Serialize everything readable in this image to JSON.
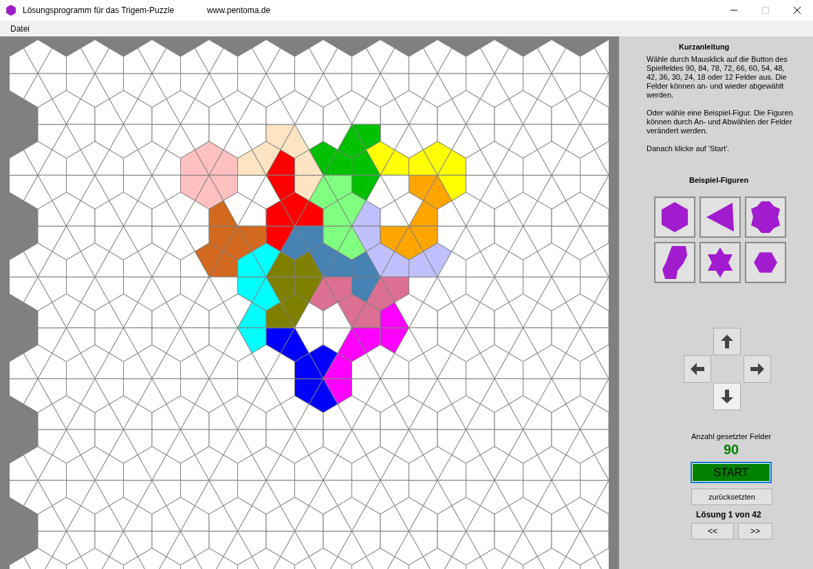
{
  "window": {
    "title": "Lösungsprogramm für das Trigem-Puzzle",
    "url": "www.pentoma.de"
  },
  "menu": [
    "Datei"
  ],
  "board": {
    "rows": [
      [
        {
          "kites": [
            {
              "color": "#ffffff"
            },
            {
              "color": "#ffffff"
            },
            {
              "color": "#ffffff"
            },
            {
              "color": "#ffffff"
            },
            {
              "color": "#ffffff"
            },
            {
              "color": "#ffffff"
            }
          ]
        },
        {
          "kites": [
            {
              "color": "#ffffff"
            },
            {
              "color": "#ffffff"
            },
            {
              "color": "#ffffff"
            },
            {
              "color": "#ffffff"
            },
            {
              "color": "#ffffff"
            },
            {
              "color": "#ffffff"
            }
          ]
        },
        {
          "kites": [
            {
              "color": "#ffffff"
            },
            {
              "color": "#ffffff"
            },
            {
              "color": "#ffffff"
            },
            {
              "color": "#ffffff"
            },
            {
              "color": "#ffffff"
            },
            {
              "color": "#ffffff"
            }
          ]
        },
        {
          "kites": [
            {
              "color": "#ffffff"
            },
            {
              "color": "#ffffff"
            },
            {
              "color": "#ffffff"
            },
            {
              "color": "#ffffff"
            },
            {
              "color": "#ffffff"
            },
            {
              "color": "#ffffff"
            }
          ]
        },
        {
          "kites": [
            {
              "color": "#ffffff"
            },
            {
              "color": "#ffffff"
            },
            {
              "color": "#ffffff"
            },
            {
              "color": "#ffe4c4"
            },
            {
              "color": "#ffe4c4"
            },
            {
              "color": "#ffffff"
            }
          ]
        },
        {
          "kites": [
            {
              "color": "#ffffff"
            },
            {
              "color": "#ffffff"
            },
            {
              "color": "#00c000"
            },
            {
              "color": "#00c000"
            },
            {
              "color": "#ffffff"
            },
            {
              "color": "#ffffff"
            }
          ]
        }
      ],
      [
        {
          "kites": [
            {
              "color": "#ffffff"
            },
            {
              "color": "#ffffff"
            },
            {
              "color": "#ffffff"
            },
            {
              "color": "#ffffff"
            },
            {
              "color": "#ffffff"
            },
            {
              "color": "#ffffff"
            }
          ]
        },
        {
          "kites": [
            {
              "color": "#ffffff"
            },
            {
              "color": "#ffffff"
            },
            {
              "color": "#ffffff"
            },
            {
              "color": "#ffffff"
            },
            {
              "color": "#ffffff"
            },
            {
              "color": "#ffffff"
            }
          ]
        },
        {
          "kites": [
            {
              "color": "#ffffff"
            },
            {
              "color": "#ffffff"
            },
            {
              "color": "#ffffff"
            },
            {
              "color": "#ffffff"
            },
            {
              "color": "#ffffff"
            },
            {
              "color": "#ffffff"
            }
          ]
        },
        {
          "kites": [
            {
              "color": "#ffc0c0"
            },
            {
              "color": "#ffc0c0"
            },
            {
              "color": "#ffc0c0"
            },
            {
              "color": "#ffc0c0"
            },
            {
              "color": "#ffc0c0"
            },
            {
              "color": "#ffc0c0"
            }
          ]
        },
        {
          "kites": [
            {
              "color": "#ffe4c4"
            },
            {
              "color": "#ff0000"
            },
            {
              "color": "#ff0000"
            },
            {
              "color": "#ffffff"
            },
            {
              "color": "#ffffff"
            },
            {
              "color": "#ffe4c4"
            }
          ]
        },
        {
          "kites": [
            {
              "color": "#00c000"
            },
            {
              "color": "#00c000"
            },
            {
              "color": "#80ff80"
            },
            {
              "color": "#80ff80"
            },
            {
              "color": "#ffe4c4"
            },
            {
              "color": "#ffe4c4"
            }
          ]
        },
        {
          "kites": [
            {
              "color": "#ffff00"
            },
            {
              "color": "#ffff00"
            },
            {
              "color": "#ffffff"
            },
            {
              "color": "#ffffff"
            },
            {
              "color": "#00c000"
            },
            {
              "color": "#00c000"
            }
          ]
        },
        {
          "kites": [
            {
              "color": "#ffff00"
            },
            {
              "color": "#ffff00"
            },
            {
              "color": "#ffff00"
            },
            {
              "color": "#ffa500"
            },
            {
              "color": "#ffa500"
            },
            {
              "color": "#ffff00"
            }
          ]
        }
      ],
      [
        {
          "kites": [
            {
              "color": "#ffffff"
            },
            {
              "color": "#ffffff"
            },
            {
              "color": "#ffffff"
            },
            {
              "color": "#ffffff"
            },
            {
              "color": "#ffffff"
            },
            {
              "color": "#ffffff"
            }
          ]
        },
        {
          "kites": [
            {
              "color": "#ffffff"
            },
            {
              "color": "#ffffff"
            },
            {
              "color": "#ffffff"
            },
            {
              "color": "#ffffff"
            },
            {
              "color": "#ffffff"
            },
            {
              "color": "#ffffff"
            }
          ]
        },
        {
          "kites": [
            {
              "color": "#ffffff"
            },
            {
              "color": "#ffffff"
            },
            {
              "color": "#ffffff"
            },
            {
              "color": "#ffffff"
            },
            {
              "color": "#ffffff"
            },
            {
              "color": "#ffffff"
            }
          ]
        },
        {
          "kites": [
            {
              "color": "#ffffff"
            },
            {
              "color": "#ffffff"
            },
            {
              "color": "#d2691e"
            },
            {
              "color": "#d2691e"
            },
            {
              "color": "#d2691e"
            },
            {
              "color": "#d2691e"
            }
          ]
        },
        {
          "kites": [
            {
              "color": "#ff0000"
            },
            {
              "color": "#ff0000"
            },
            {
              "color": "#4682b4"
            },
            {
              "color": "#4682b4"
            },
            {
              "color": "#ff0000"
            },
            {
              "color": "#ff0000"
            }
          ]
        },
        {
          "kites": [
            {
              "color": "#80ff80"
            },
            {
              "color": "#c0c0ff"
            },
            {
              "color": "#c0c0ff"
            },
            {
              "color": "#80ff80"
            },
            {
              "color": "#80ff80"
            },
            {
              "color": "#80ff80"
            }
          ]
        },
        {
          "kites": [
            {
              "color": "#ffffff"
            },
            {
              "color": "#ffa500"
            },
            {
              "color": "#ffa500"
            },
            {
              "color": "#ffa500"
            },
            {
              "color": "#ffa500"
            },
            {
              "color": "#ffffff"
            }
          ]
        }
      ],
      [
        {
          "kites": [
            {
              "color": "#ffffff"
            },
            {
              "color": "#ffffff"
            },
            {
              "color": "#ffffff"
            },
            {
              "color": "#ffffff"
            },
            {
              "color": "#ffffff"
            },
            {
              "color": "#ffffff"
            }
          ]
        },
        {
          "kites": [
            {
              "color": "#ffffff"
            },
            {
              "color": "#ffffff"
            },
            {
              "color": "#ffffff"
            },
            {
              "color": "#ffffff"
            },
            {
              "color": "#ffffff"
            },
            {
              "color": "#ffffff"
            }
          ]
        },
        {
          "kites": [
            {
              "color": "#ffffff"
            },
            {
              "color": "#ffffff"
            },
            {
              "color": "#ffffff"
            },
            {
              "color": "#ffffff"
            },
            {
              "color": "#ffffff"
            },
            {
              "color": "#ffffff"
            }
          ]
        },
        {
          "kites": [
            {
              "color": "#d2691e"
            },
            {
              "color": "#d2691e"
            },
            {
              "color": "#ffffff"
            },
            {
              "color": "#ffffff"
            },
            {
              "color": "#ffffff"
            },
            {
              "color": "#ffffff"
            }
          ]
        },
        {
          "kites": [
            {
              "color": "#00ffff"
            },
            {
              "color": "#808000"
            },
            {
              "color": "#808000"
            },
            {
              "color": "#00ffff"
            },
            {
              "color": "#00ffff"
            },
            {
              "color": "#00ffff"
            }
          ]
        },
        {
          "kites": [
            {
              "color": "#4682b4"
            },
            {
              "color": "#4682b4"
            },
            {
              "color": "#db7093"
            },
            {
              "color": "#db7093"
            },
            {
              "color": "#808000"
            },
            {
              "color": "#808000"
            }
          ]
        },
        {
          "kites": [
            {
              "color": "#c0c0ff"
            },
            {
              "color": "#c0c0ff"
            },
            {
              "color": "#db7093"
            },
            {
              "color": "#db7093"
            },
            {
              "color": "#4682b4"
            },
            {
              "color": "#4682b4"
            }
          ]
        },
        {
          "kites": [
            {
              "color": "#c0c0ff"
            },
            {
              "color": "#ffffff"
            },
            {
              "color": "#ffffff"
            },
            {
              "color": "#ffffff"
            },
            {
              "color": "#ffffff"
            },
            {
              "color": "#c0c0ff"
            }
          ]
        }
      ],
      [
        {
          "kites": [
            {
              "color": "#ffffff"
            },
            {
              "color": "#ffffff"
            },
            {
              "color": "#ffffff"
            },
            {
              "color": "#ffffff"
            },
            {
              "color": "#ffffff"
            },
            {
              "color": "#ffffff"
            }
          ]
        },
        {
          "kites": [
            {
              "color": "#ffffff"
            },
            {
              "color": "#ffffff"
            },
            {
              "color": "#ffffff"
            },
            {
              "color": "#ffffff"
            },
            {
              "color": "#ffffff"
            },
            {
              "color": "#ffffff"
            }
          ]
        },
        {
          "kites": [
            {
              "color": "#ffffff"
            },
            {
              "color": "#ffffff"
            },
            {
              "color": "#ffffff"
            },
            {
              "color": "#ffffff"
            },
            {
              "color": "#ffffff"
            },
            {
              "color": "#ffffff"
            }
          ]
        },
        {
          "kites": [
            {
              "color": "#ffffff"
            },
            {
              "color": "#00ffff"
            },
            {
              "color": "#00ffff"
            },
            {
              "color": "#ffffff"
            },
            {
              "color": "#ffffff"
            },
            {
              "color": "#ffffff"
            }
          ]
        },
        {
          "kites": [
            {
              "color": "#808000"
            },
            {
              "color": "#ffffff"
            },
            {
              "color": "#ffffff"
            },
            {
              "color": "#0000ff"
            },
            {
              "color": "#0000ff"
            },
            {
              "color": "#808000"
            }
          ]
        },
        {
          "kites": [
            {
              "color": "#db7093"
            },
            {
              "color": "#db7093"
            },
            {
              "color": "#ff00ff"
            },
            {
              "color": "#ff00ff"
            },
            {
              "color": "#ffffff"
            },
            {
              "color": "#ffffff"
            }
          ]
        },
        {
          "kites": [
            {
              "color": "#ffffff"
            },
            {
              "color": "#ffffff"
            },
            {
              "color": "#ffffff"
            },
            {
              "color": "#ffffff"
            },
            {
              "color": "#ff00ff"
            },
            {
              "color": "#ff00ff"
            }
          ]
        }
      ],
      [
        {
          "kites": [
            {
              "color": "#ffffff"
            },
            {
              "color": "#ffffff"
            },
            {
              "color": "#ffffff"
            },
            {
              "color": "#ffffff"
            },
            {
              "color": "#ffffff"
            },
            {
              "color": "#ffffff"
            }
          ]
        },
        {
          "kites": [
            {
              "color": "#ffffff"
            },
            {
              "color": "#ffffff"
            },
            {
              "color": "#ffffff"
            },
            {
              "color": "#ffffff"
            },
            {
              "color": "#ffffff"
            },
            {
              "color": "#ffffff"
            }
          ]
        },
        {
          "kites": [
            {
              "color": "#ffffff"
            },
            {
              "color": "#ffffff"
            },
            {
              "color": "#ffffff"
            },
            {
              "color": "#ffffff"
            },
            {
              "color": "#ffffff"
            },
            {
              "color": "#ffffff"
            }
          ]
        },
        {
          "kites": [
            {
              "color": "#ffffff"
            },
            {
              "color": "#ffffff"
            },
            {
              "color": "#ffffff"
            },
            {
              "color": "#ffffff"
            },
            {
              "color": "#ffffff"
            },
            {
              "color": "#ffffff"
            }
          ]
        },
        {
          "kites": [
            {
              "color": "#ffffff"
            },
            {
              "color": "#ffffff"
            },
            {
              "color": "#ffffff"
            },
            {
              "color": "#ffffff"
            },
            {
              "color": "#ffffff"
            },
            {
              "color": "#ffffff"
            }
          ]
        },
        {
          "kites": [
            {
              "color": "#0000ff"
            },
            {
              "color": "#ff00ff"
            },
            {
              "color": "#ff00ff"
            },
            {
              "color": "#0000ff"
            },
            {
              "color": "#0000ff"
            },
            {
              "color": "#0000ff"
            }
          ]
        }
      ]
    ]
  },
  "instructions": {
    "title": "Kurzanleitung",
    "paragraphs": [
      "Wähle durch Mausklick auf die Button des Spielfeldes 90, 84, 78, 72, 66, 60, 54, 48, 42, 36, 30, 24, 18 oder 12 Felder aus. Die Felder können an- und wieder abgewählt werden.",
      "Oder wähle eine Beispiel-Figur. Die Figuren können  durch An- und Abwählen der Felder verändert werden.",
      "Danach klicke auf 'Start'."
    ]
  },
  "examples": {
    "title": "Beispiel-Figuren",
    "figures": [
      {
        "kind": "hexagon"
      },
      {
        "kind": "triangle"
      },
      {
        "kind": "notched"
      },
      {
        "kind": "slanted"
      },
      {
        "kind": "star"
      },
      {
        "kind": "small"
      }
    ]
  },
  "counter": {
    "label": "Anzahl gesetzter Felder",
    "value": "90"
  },
  "start_button": "START",
  "reset_button": "zurücksetzten",
  "solution": {
    "label": "Lösung 1 von 42",
    "prev": "<<",
    "next": ">>"
  }
}
